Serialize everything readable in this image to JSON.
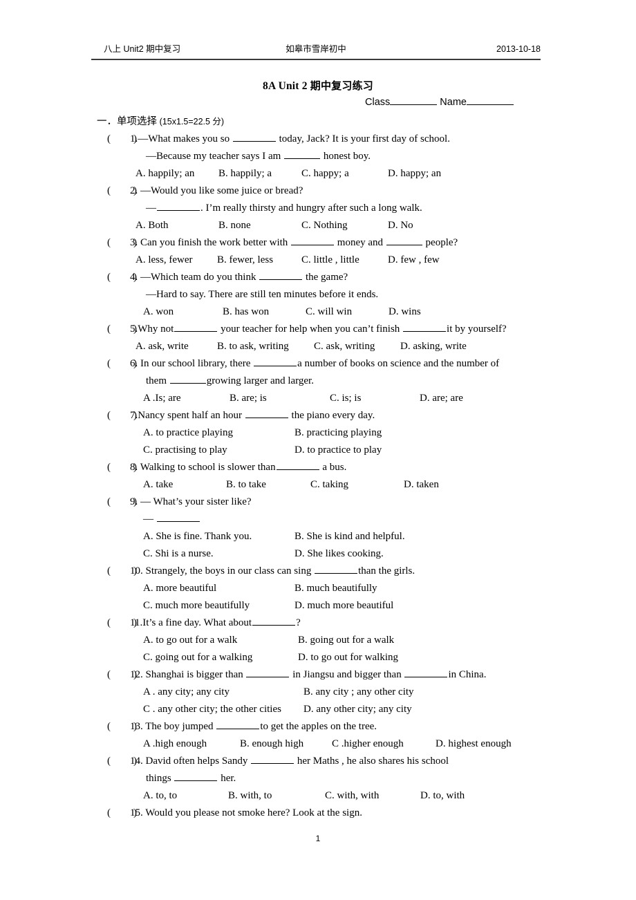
{
  "header": {
    "left": "八上 Unit2  期中复习",
    "center": "如皋市雪岸初中",
    "right": "2013-10-18"
  },
  "title": {
    "en": "8A Unit 2 ",
    "cn": "期中复习练习"
  },
  "class_name": {
    "class_label": "Class",
    "name_label": "Name"
  },
  "section": {
    "number": "一．",
    "title_cn": "单项选择",
    "points": "(15x1.5=22.5 分)"
  },
  "page_number": "1",
  "questions": [
    {
      "mark": "(",
      "mark_close": ")",
      "num": "1.",
      "stem_pre": "—What makes you so ",
      "stem_post": " today, Jack? It is your first day of school.",
      "cont_pre": "—Because my teacher says I am ",
      "cont_post": " honest boy.",
      "options": [
        "A. happily; an",
        "B. happily; a",
        "C. happy; a",
        "D. happy; an"
      ]
    },
    {
      "mark": "(",
      "mark_close": ")",
      "num": "2. ",
      "stem_pre": "—Would you like some juice or bread?",
      "stem_post": "",
      "cont_pre": "—",
      "cont_post": ". I’m really thirsty and hungry after such a long walk.",
      "options": [
        "A. Both",
        "B. none",
        "C. Nothing",
        "D. No"
      ]
    },
    {
      "mark": "(",
      "mark_close": ")",
      "num": "3. ",
      "stem_pre": "Can you finish the work better with ",
      "stem_mid": " money and ",
      "stem_post": " people?",
      "options": [
        "A. less, fewer",
        "B. fewer, less",
        "C. little , little",
        "D. few , few"
      ]
    },
    {
      "mark": "(",
      "mark_close": ")",
      "num": "4. ",
      "stem_pre": "—Which team do you think ",
      "stem_post": " the game?",
      "cont_pre": "—Hard to say. There are still ten minutes before it ends.",
      "cont_post": "",
      "options": [
        "A. won",
        "B. has won",
        "C. will win",
        "D. wins"
      ]
    },
    {
      "mark": "(",
      "mark_close": ")",
      "num": "5.",
      "stem_pre": "Why not",
      "stem_mid": " your teacher for help when you can’t finish ",
      "stem_post": "it by yourself?",
      "options": [
        "A. ask, write",
        "B. to ask, writing",
        "C. ask, writing",
        "D. asking, write"
      ]
    },
    {
      "mark": "(",
      "mark_close": ")",
      "num": "6. ",
      "stem_pre": "In our school library, there ",
      "stem_post": "a number of books on science and the number of",
      "cont_pre": "them ",
      "cont_post": "growing larger and larger.",
      "options": [
        "A .Is; are",
        "B. are; is",
        "C. is; is",
        "D. are; are"
      ]
    },
    {
      "mark": "(",
      "mark_close": ")",
      "num": "7.",
      "stem_pre": "Nancy spent half an hour ",
      "stem_post": " the piano every day.",
      "options": [
        "A. to practice playing",
        "B.   practicing   playing",
        "C. practising   to play",
        "D.   to practice   to play"
      ]
    },
    {
      "mark": "(",
      "mark_close": ")",
      "num": "8. ",
      "stem_pre": "Walking to school is slower than",
      "stem_post": " a bus.",
      "options": [
        "A. take",
        "B. to take",
        "C. taking",
        "D. taken"
      ]
    },
    {
      "mark": "(",
      "mark_close": ")",
      "num": "9. ",
      "stem_pre": "— What’s your sister like?",
      "stem_post": "",
      "dash_blank": "—",
      "options": [
        "A.   She is fine. Thank you.",
        "B. She is kind and helpful.",
        "C. Shi is a nurse.",
        "D. She likes cooking."
      ]
    },
    {
      "mark": "(",
      "mark_close": ")",
      "num": "10. ",
      "stem_pre": "Strangely, the boys in our class can sing ",
      "stem_post": "than the girls.",
      "options": [
        "A. more beautiful",
        "B. much beautifully",
        "C. much more beautifully",
        "D. much more beautiful"
      ]
    },
    {
      "mark": "(",
      "mark_close": ")",
      "num": "11.",
      "stem_pre": "It’s a fine day. What about",
      "stem_post": "?",
      "options": [
        "A. to go out for a walk",
        "B. going out for a walk",
        "C. going out for a walking",
        "D. to go out for walking"
      ]
    },
    {
      "mark": "(",
      "mark_close": ")",
      "num": "12. ",
      "stem_pre": "Shanghai is bigger than ",
      "stem_mid": " in Jiangsu and bigger than ",
      "stem_post": "in China.",
      "options": [
        "A . any city; any city",
        "B.   any city ; any other city",
        "C . any other city; the other cities",
        "D.   any other city; any city"
      ]
    },
    {
      "mark": "(",
      "mark_close": ")",
      "num": "13. ",
      "stem_pre": "The boy jumped ",
      "stem_post": "to get the apples on the tree.",
      "options": [
        "A .high enough",
        "B. enough high",
        "C .higher enough",
        "D. highest enough"
      ]
    },
    {
      "mark": "(",
      "mark_close": ")",
      "num": "14. ",
      "stem_pre": "David often helps Sandy ",
      "stem_post": " her Maths , he also shares his school",
      "cont_pre": "things ",
      "cont_post": " her.",
      "options": [
        "A. to, to",
        "B. with, to",
        "C. with, with",
        "D. to, with"
      ]
    },
    {
      "mark": "(",
      "mark_close": ")",
      "num": " 15. ",
      "stem_pre": "Would you please not smoke here? Look at the sign.",
      "stem_post": "",
      "options": []
    }
  ]
}
